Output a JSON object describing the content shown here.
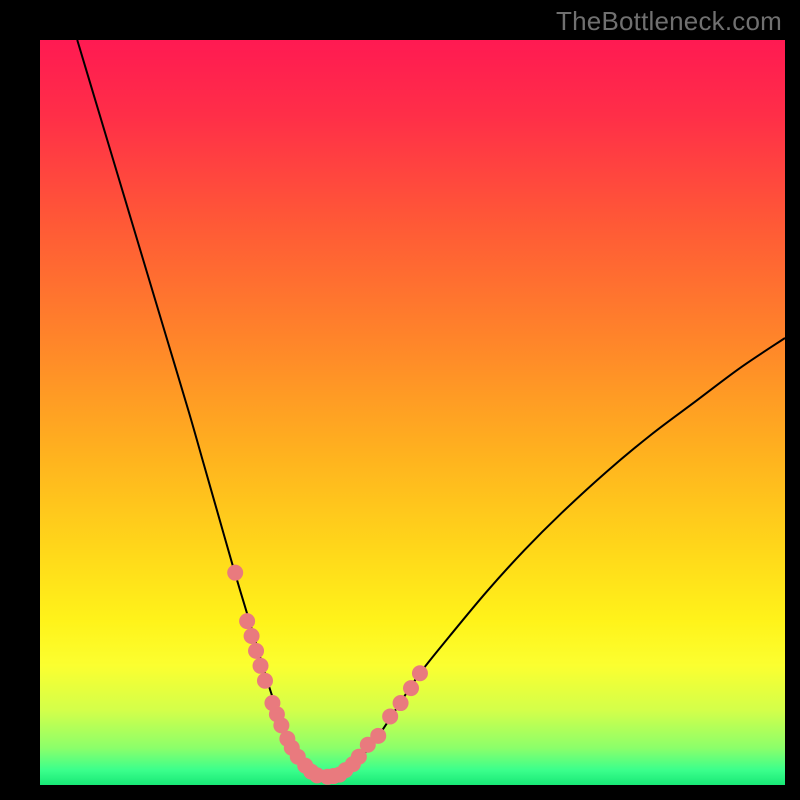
{
  "watermark": "TheBottleneck.com",
  "colors": {
    "frame": "#000000",
    "curve_stroke": "#000000",
    "marker_fill": "#e97a7e",
    "gradient_stops": [
      {
        "offset": 0.0,
        "color": "#ff1a52"
      },
      {
        "offset": 0.1,
        "color": "#ff2e48"
      },
      {
        "offset": 0.25,
        "color": "#ff5a36"
      },
      {
        "offset": 0.4,
        "color": "#ff842a"
      },
      {
        "offset": 0.55,
        "color": "#ffb01f"
      },
      {
        "offset": 0.68,
        "color": "#ffd61a"
      },
      {
        "offset": 0.78,
        "color": "#fff31a"
      },
      {
        "offset": 0.84,
        "color": "#fbff30"
      },
      {
        "offset": 0.9,
        "color": "#d3ff4a"
      },
      {
        "offset": 0.95,
        "color": "#8cff6a"
      },
      {
        "offset": 0.98,
        "color": "#3bff8c"
      },
      {
        "offset": 1.0,
        "color": "#18e876"
      }
    ]
  },
  "chart_data": {
    "type": "line",
    "title": "",
    "xlabel": "",
    "ylabel": "",
    "xlim": [
      0,
      100
    ],
    "ylim": [
      0,
      100
    ],
    "grid": false,
    "series": [
      {
        "name": "bottleneck-curve",
        "x": [
          5,
          8,
          11,
          14,
          17,
          20,
          22,
          24,
          26,
          27.5,
          29,
          30.5,
          32,
          33.5,
          35,
          36.5,
          38,
          40,
          42,
          45,
          48,
          51,
          55,
          60,
          65,
          70,
          76,
          82,
          88,
          94,
          100
        ],
        "y": [
          100,
          90,
          80,
          70,
          60,
          50,
          43,
          36,
          29,
          24,
          19,
          14,
          9.5,
          6,
          3.4,
          1.8,
          1.0,
          1.2,
          2.6,
          6.0,
          10.5,
          15,
          20,
          26,
          31.5,
          36.5,
          42,
          47,
          51.5,
          56,
          60
        ]
      }
    ],
    "markers": [
      {
        "name": "highlight-dots",
        "x": [
          26.2,
          27.8,
          28.4,
          29.0,
          29.6,
          30.2,
          31.2,
          31.8,
          32.4,
          33.2,
          33.8,
          34.6,
          35.6,
          36.4,
          37.2,
          38.6,
          39.4,
          40.2,
          41.0,
          42.0,
          42.8,
          44.0,
          45.4,
          47.0,
          48.4,
          49.8,
          51.0
        ],
        "y": [
          28.5,
          22.0,
          20.0,
          18.0,
          16.0,
          14.0,
          11.0,
          9.5,
          8.0,
          6.2,
          5.0,
          3.8,
          2.6,
          1.8,
          1.3,
          1.1,
          1.2,
          1.4,
          2.0,
          2.8,
          3.8,
          5.4,
          6.6,
          9.2,
          11.0,
          13.0,
          15.0
        ]
      }
    ],
    "annotations": []
  }
}
